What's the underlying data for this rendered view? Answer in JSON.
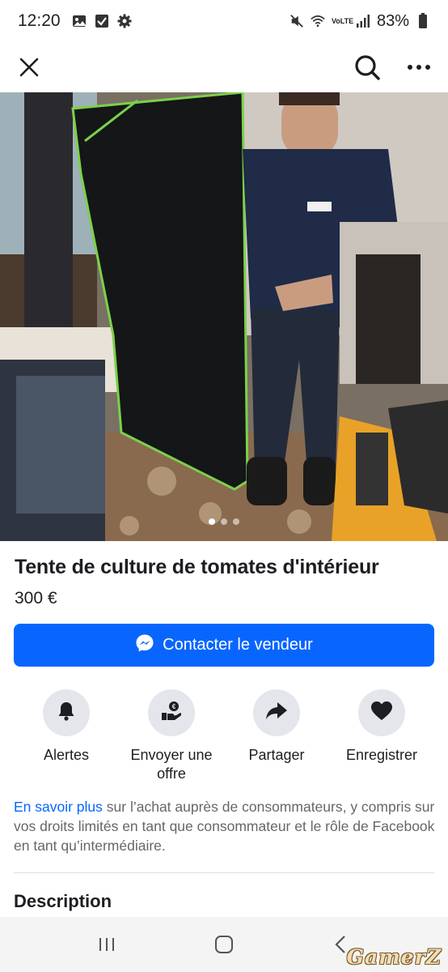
{
  "status_bar": {
    "time": "12:20",
    "battery": "83%",
    "network": "VoLTE",
    "left_icons": [
      "gallery-icon",
      "checkbox-icon",
      "settings-gear-icon"
    ],
    "right_icons": [
      "mute-icon",
      "wifi-icon",
      "volte-icon",
      "signal-icon",
      "battery-icon"
    ]
  },
  "top_nav": {
    "icons": [
      "close-icon",
      "search-icon",
      "more-options-icon"
    ]
  },
  "photo": {
    "image_count": 3,
    "active_index": 0
  },
  "listing": {
    "title": "Tente de culture de tomates d'intérieur",
    "price": "300 €"
  },
  "contact_button": {
    "label": "Contacter le vendeur",
    "icon": "messenger-icon",
    "color": "#0866ff"
  },
  "actions": [
    {
      "label": "Alertes",
      "icon": "bell-icon"
    },
    {
      "label": "Envoyer une offre",
      "icon": "send-offer-icon"
    },
    {
      "label": "Partager",
      "icon": "share-icon"
    },
    {
      "label": "Enregistrer",
      "icon": "heart-icon"
    }
  ],
  "info": {
    "link_text": "En savoir plus",
    "rest_text": " sur l’achat auprès de consommateurs, y compris sur vos droits limités en tant que consommateur et le rôle de Facebook en tant qu’intermédiaire."
  },
  "description": {
    "heading": "Description"
  },
  "android_nav": {
    "icons": [
      "recent-apps-icon",
      "home-icon",
      "back-icon"
    ]
  },
  "watermark": "GamerZ"
}
